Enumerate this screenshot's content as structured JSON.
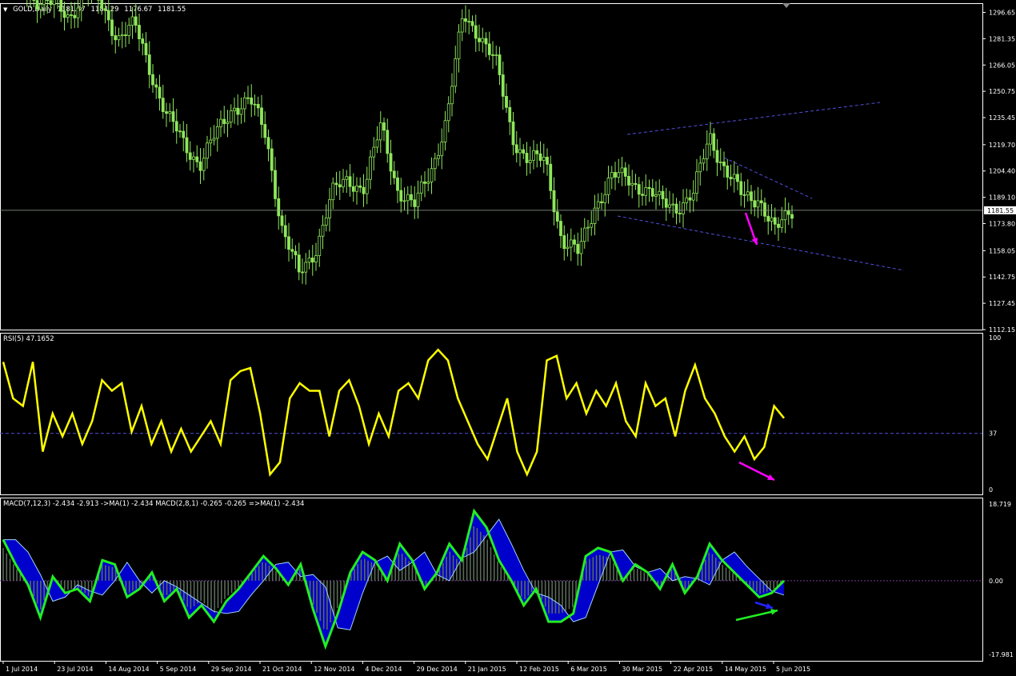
{
  "header": {
    "symbol": "GOLD,Daily",
    "open": "1181.37",
    "high": "1184.29",
    "low": "1176.67",
    "close": "1181.55"
  },
  "rsi_header": "RSI(5) 47.1652",
  "macd_header": "MACD(7,12,3) -2.434 -2.913  ->MA(1) -2.434  MACD(2,8,1) -0.265 -0.265  =>MA(1) -2.434",
  "colors": {
    "candles": "#8ee65a",
    "rsi": "#ffff00",
    "macd_main": "#22ee22",
    "macd_fill": "#0000cc",
    "histogram": "#5a6a5a",
    "trendlines": "#5050dd",
    "arrow_magenta": "#ff00ff",
    "arrow_green": "#22ee22",
    "arrow_blue": "#2222ff"
  },
  "chart_data": [
    {
      "type": "candlestick",
      "ylim": [
        1112.15,
        1302.0
      ],
      "yticks": [
        1296.65,
        1281.35,
        1266.05,
        1250.75,
        1235.45,
        1219.7,
        1204.4,
        1189.1,
        1173.8,
        1158.05,
        1142.75,
        1127.45,
        1112.15
      ],
      "current_price": 1181.55,
      "x_labels": [
        "1 Jul 2014",
        "23 Jul 2014",
        "14 Aug 2014",
        "5 Sep 2014",
        "29 Sep 2014",
        "21 Oct 2014",
        "12 Nov 2014",
        "4 Dec 2014",
        "29 Dec 2014",
        "21 Jan 2015",
        "12 Feb 2015",
        "6 Mar 2015",
        "30 Mar 2015",
        "22 Apr 2015",
        "14 May 2015",
        "5 Jun 2015"
      ],
      "close_path": [
        [
          "1 Jul 2014",
          1320
        ],
        [
          "8 Jul 2014",
          1315
        ],
        [
          "16 Jul 2014",
          1305
        ],
        [
          "23 Jul 2014",
          1300
        ],
        [
          "31 Jul 2014",
          1295
        ],
        [
          "6 Aug 2014",
          1310
        ],
        [
          "14 Aug 2014",
          1300
        ],
        [
          "20 Aug 2014",
          1283
        ],
        [
          "28 Aug 2014",
          1288
        ],
        [
          "5 Sep 2014",
          1263
        ],
        [
          "12 Sep 2014",
          1235
        ],
        [
          "19 Sep 2014",
          1220
        ],
        [
          "29 Sep 2014",
          1210
        ],
        [
          "7 Oct 2014",
          1225
        ],
        [
          "14 Oct 2014",
          1243
        ],
        [
          "21 Oct 2014",
          1245
        ],
        [
          "28 Oct 2014",
          1225
        ],
        [
          "3 Nov 2014",
          1170
        ],
        [
          "7 Nov 2014",
          1143
        ],
        [
          "12 Nov 2014",
          1160
        ],
        [
          "19 Nov 2014",
          1190
        ],
        [
          "26 Nov 2014",
          1200
        ],
        [
          "4 Dec 2014",
          1195
        ],
        [
          "11 Dec 2014",
          1230
        ],
        [
          "18 Dec 2014",
          1195
        ],
        [
          "29 Dec 2014",
          1182
        ],
        [
          "5 Jan 2015",
          1205
        ],
        [
          "12 Jan 2015",
          1235
        ],
        [
          "21 Jan 2015",
          1295
        ],
        [
          "28 Jan 2015",
          1285
        ],
        [
          "3 Feb 2015",
          1265
        ],
        [
          "12 Feb 2015",
          1225
        ],
        [
          "20 Feb 2015",
          1210
        ],
        [
          "27 Feb 2015",
          1210
        ],
        [
          "6 Mar 2015",
          1165
        ],
        [
          "13 Mar 2015",
          1155
        ],
        [
          "20 Mar 2015",
          1185
        ],
        [
          "30 Mar 2015",
          1200
        ],
        [
          "7 Apr 2015",
          1200
        ],
        [
          "15 Apr 2015",
          1195
        ],
        [
          "22 Apr 2015",
          1185
        ],
        [
          "29 Apr 2015",
          1185
        ],
        [
          "7 May 2015",
          1190
        ],
        [
          "14 May 2015",
          1225
        ],
        [
          "21 May 2015",
          1205
        ],
        [
          "28 May 2015",
          1188
        ],
        [
          "1 Jun 2015",
          1190
        ],
        [
          "5 Jun 2015",
          1168
        ],
        [
          "11 Jun 2015",
          1181.55
        ]
      ]
    },
    {
      "type": "line",
      "name": "RSI(5)",
      "ylim": [
        0,
        100
      ],
      "yticks": [
        100,
        37,
        0
      ],
      "level": 37,
      "values": [
        84,
        60,
        55,
        84,
        25,
        50,
        35,
        50,
        30,
        45,
        72,
        65,
        70,
        38,
        55,
        30,
        45,
        25,
        40,
        25,
        35,
        45,
        30,
        72,
        78,
        80,
        50,
        10,
        18,
        60,
        70,
        65,
        65,
        35,
        65,
        72,
        55,
        30,
        50,
        35,
        65,
        70,
        60,
        85,
        92,
        85,
        60,
        45,
        30,
        20,
        40,
        60,
        25,
        10,
        25,
        85,
        88,
        60,
        70,
        50,
        65,
        55,
        70,
        45,
        35,
        70,
        55,
        60,
        35,
        65,
        82,
        60,
        50,
        35,
        25,
        35,
        20,
        28,
        55,
        47
      ]
    },
    {
      "type": "line",
      "name": "MACD(7,12,3)",
      "ylim": [
        -17.981,
        18.719
      ],
      "yticks": [
        18.719,
        0.0,
        -17.981
      ],
      "values": [
        10,
        4,
        -1,
        -9,
        1,
        -3,
        -2,
        -5,
        5,
        4,
        -4,
        -2,
        2,
        -5,
        -2,
        -9,
        -6,
        -10,
        -5,
        -2,
        2,
        6,
        3,
        -1,
        4,
        -7,
        -16,
        -8,
        2,
        7,
        5,
        0,
        9,
        5,
        -2,
        2,
        9,
        5,
        17,
        13,
        5,
        0,
        -6,
        -2,
        -10,
        -10,
        -8,
        6,
        8,
        7,
        0,
        4,
        2,
        -2,
        4,
        -3,
        1,
        9,
        5,
        2,
        -1,
        -4,
        -3,
        0
      ]
    }
  ]
}
